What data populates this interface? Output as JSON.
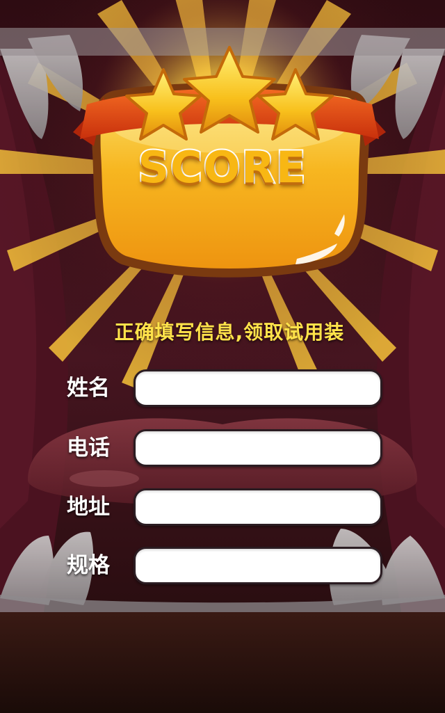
{
  "score_panel": {
    "title": "SCORE",
    "stars": 3
  },
  "subtitle": "正确填写信息,领取试用装",
  "form": {
    "fields": [
      {
        "label": "姓名",
        "value": "",
        "placeholder": ""
      },
      {
        "label": "电话",
        "value": "",
        "placeholder": ""
      },
      {
        "label": "地址",
        "value": "",
        "placeholder": ""
      },
      {
        "label": "规格",
        "value": "",
        "placeholder": ""
      }
    ]
  },
  "colors": {
    "background": "#3a0d16",
    "panel_gold": "#f8b714",
    "ribbon_red": "#e0400f",
    "subtitle_yellow": "#ffe34a",
    "label_white": "#ffffff",
    "input_bg": "#ffffff"
  }
}
